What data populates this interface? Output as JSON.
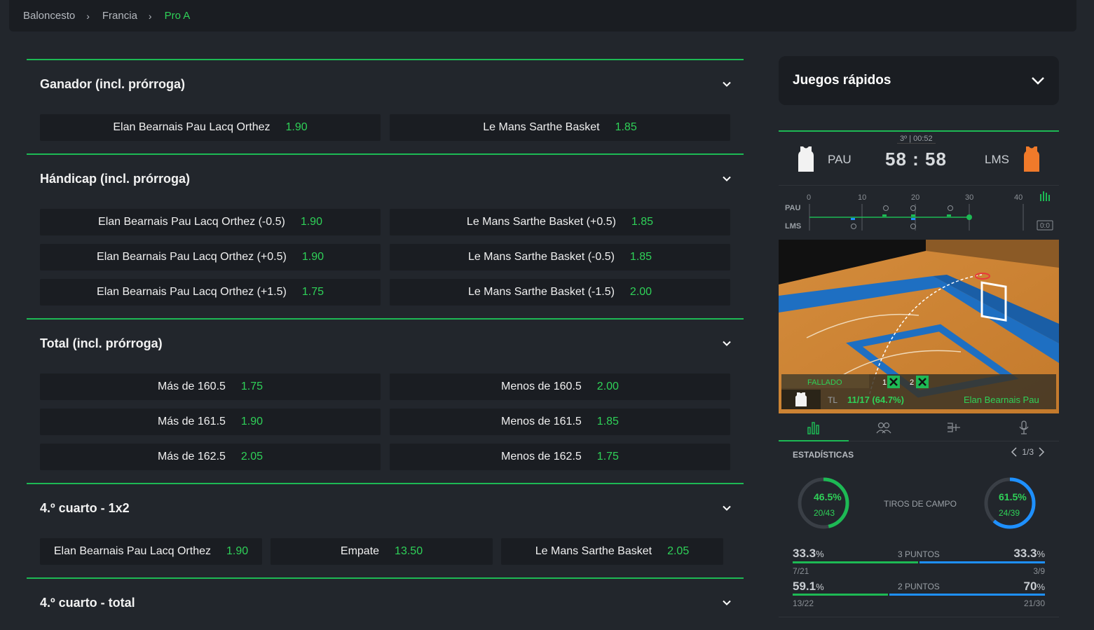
{
  "breadcrumb": [
    "Baloncesto",
    "Francia",
    "Pro A"
  ],
  "markets": [
    {
      "title": "Ganador (incl. prórroga)",
      "rows": [
        [
          [
            "Elan Bearnais Pau Lacq Orthez",
            "1.90"
          ],
          [
            "Le Mans Sarthe Basket",
            "1.85"
          ]
        ]
      ]
    },
    {
      "title": "Hándicap (incl. prórroga)",
      "rows": [
        [
          [
            "Elan Bearnais Pau Lacq Orthez (-0.5)",
            "1.90"
          ],
          [
            "Le Mans Sarthe Basket (+0.5)",
            "1.85"
          ]
        ],
        [
          [
            "Elan Bearnais Pau Lacq Orthez (+0.5)",
            "1.90"
          ],
          [
            "Le Mans Sarthe Basket (-0.5)",
            "1.85"
          ]
        ],
        [
          [
            "Elan Bearnais Pau Lacq Orthez (+1.5)",
            "1.75"
          ],
          [
            "Le Mans Sarthe Basket (-1.5)",
            "2.00"
          ]
        ]
      ]
    },
    {
      "title": "Total (incl. prórroga)",
      "rows": [
        [
          [
            "Más de 160.5",
            "1.75"
          ],
          [
            "Menos de 160.5",
            "2.00"
          ]
        ],
        [
          [
            "Más de 161.5",
            "1.90"
          ],
          [
            "Menos de 161.5",
            "1.85"
          ]
        ],
        [
          [
            "Más de 162.5",
            "2.05"
          ],
          [
            "Menos de 162.5",
            "1.75"
          ]
        ]
      ]
    },
    {
      "title": "4.º cuarto - 1x2",
      "rows": [
        [
          [
            "Elan Bearnais Pau Lacq Orthez",
            "1.90"
          ],
          [
            "Empate",
            "13.50"
          ],
          [
            "Le Mans Sarthe Basket",
            "2.05"
          ]
        ]
      ]
    },
    {
      "title": "4.º cuarto - total",
      "rows": []
    }
  ],
  "quick_games": {
    "title": "Juegos rápidos"
  },
  "scoreboard": {
    "clock": "3º | 00:52",
    "home": "PAU",
    "away": "LMS",
    "score": "58 : 58",
    "timeline_ticks": [
      "0",
      "10",
      "20",
      "30",
      "40"
    ],
    "timeline_home": "PAU",
    "timeline_away": "LMS",
    "timeline_toggle": "0:0",
    "colors": {
      "home": "#ffffff",
      "away": "#f07a2a",
      "accent": "#1db954",
      "blue": "#1e90ff"
    }
  },
  "court_overlay": {
    "result": "FALLADO",
    "shot1": "1",
    "shot2": "2",
    "type": "TL",
    "stat": "11/17 (64.7%)",
    "team": "Elan Bearnais Pau"
  },
  "tabs": [
    "stats-icon",
    "players-icon",
    "bracket-icon",
    "microphone-icon"
  ],
  "stats": {
    "heading": "ESTADÍSTICAS",
    "page": "1/3",
    "field_goals": {
      "label": "TIROS DE CAMPO",
      "home_pct": "46.5%",
      "home_frac": "20/43",
      "home_value": 0.465,
      "away_pct": "61.5%",
      "away_frac": "24/39",
      "away_value": 0.615
    },
    "three": {
      "label": "3 PUNTOS",
      "home_pct": "33.3",
      "home_frac": "7/21",
      "away_pct": "33.3",
      "away_frac": "3/9",
      "home_value": 0.5,
      "away_value": 0.5
    },
    "two": {
      "label": "2 PUNTOS",
      "home_pct": "59.1",
      "home_frac": "13/22",
      "away_pct": "70",
      "away_frac": "21/30",
      "home_value": 0.38,
      "away_value": 0.62
    }
  }
}
